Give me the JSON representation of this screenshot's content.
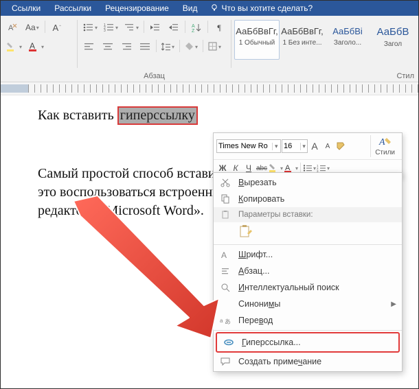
{
  "tabs": {
    "items": [
      "Ссылки",
      "Рассылки",
      "Рецензирование",
      "Вид"
    ],
    "tell_me": "Что вы хотите сделать?"
  },
  "ribbon": {
    "font": {
      "case_btn": "Aa"
    },
    "paragraph": {
      "label": "Абзац"
    },
    "styles": {
      "label": "Стил",
      "items": [
        {
          "preview": "АаБбВвГг,",
          "name": "1 Обычный"
        },
        {
          "preview": "АаБбВвГг,",
          "name": "1 Без инте..."
        },
        {
          "preview": "АаБбВі",
          "name": "Заголо..."
        },
        {
          "preview": "АаБбВ",
          "name": "Загол"
        }
      ]
    }
  },
  "document": {
    "line1_before": "Как вставить ",
    "selection": "гиперссылку",
    "para2": "Самый простой способ вставить в документ гиперссылку – это воспользоваться встроенными средствами текстового редактора «Microsoft Word»."
  },
  "mini_toolbar": {
    "font_name": "Times New Ro",
    "font_size": "16",
    "grow": "A",
    "shrink": "A",
    "styles_label": "Стили",
    "bold": "Ж",
    "italic": "К",
    "underline": "Ч",
    "strike": "abc"
  },
  "context_menu": {
    "cut": "Вырезать",
    "copy": "Копировать",
    "paste_header": "Параметры вставки:",
    "font": "Шрифт...",
    "paragraph": "Абзац...",
    "smart_lookup": "Интеллектуальный поиск",
    "synonyms": "Синонимы",
    "translate": "Перевод",
    "hyperlink": "Гиперссылка...",
    "new_comment": "Создать примечание"
  }
}
